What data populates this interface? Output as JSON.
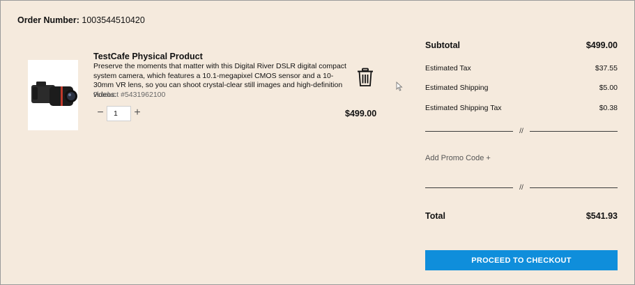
{
  "order": {
    "label": "Order Number:",
    "number": "1003544510420"
  },
  "product": {
    "title": "TestCafe Physical Product",
    "description": "Preserve the moments that matter with this Digital River DSLR digital compact system camera, which features a 10.1-megapixel CMOS sensor and a 10-30mm VR lens, so you can shoot crystal-clear still images and high-definition videos.",
    "sku": "Product #5431962100",
    "quantity": "1",
    "price": "$499.00",
    "image_icon": "camera-icon",
    "remove_icon": "trash-icon"
  },
  "summary": {
    "subtotal_label": "Subtotal",
    "subtotal_value": "$499.00",
    "tax_label": "Estimated Tax",
    "tax_value": "$37.55",
    "shipping_label": "Estimated Shipping",
    "shipping_value": "$5.00",
    "shipping_tax_label": "Estimated Shipping Tax",
    "shipping_tax_value": "$0.38",
    "divider_text": "//",
    "promo_label": "Add Promo Code +",
    "total_label": "Total",
    "total_value": "$541.93",
    "checkout_label": "PROCEED TO CHECKOUT"
  },
  "colors": {
    "background": "#f5eadd",
    "checkout_button": "#0f8edb"
  }
}
